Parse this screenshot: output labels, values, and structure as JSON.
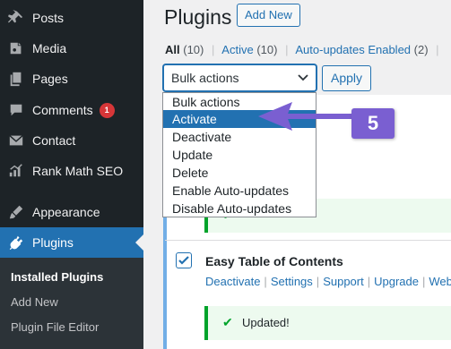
{
  "sidebar": {
    "items": [
      {
        "label": "Posts",
        "icon": "pin-icon"
      },
      {
        "label": "Media",
        "icon": "media-icon"
      },
      {
        "label": "Pages",
        "icon": "pages-icon"
      },
      {
        "label": "Comments",
        "icon": "comments-icon",
        "badge": "1"
      },
      {
        "label": "Contact",
        "icon": "mail-icon"
      },
      {
        "label": "Rank Math SEO",
        "icon": "chart-icon"
      },
      {
        "label": "Appearance",
        "icon": "brush-icon"
      },
      {
        "label": "Plugins",
        "icon": "plugin-icon",
        "active": true
      }
    ],
    "submenu": [
      "Installed Plugins",
      "Add New",
      "Plugin File Editor"
    ]
  },
  "header": {
    "title": "Plugins",
    "add_new": "Add New"
  },
  "filters": {
    "all": "All",
    "all_count": "(10)",
    "active": "Active",
    "active_count": "(10)",
    "auto": "Auto-updates Enabled",
    "auto_count": "(2)"
  },
  "bulk": {
    "selected": "Bulk actions",
    "apply": "Apply",
    "options": [
      "Bulk actions",
      "Activate",
      "Deactivate",
      "Update",
      "Delete",
      "Enable Auto-updates",
      "Disable Auto-updates"
    ]
  },
  "plugin_row": {
    "name": "Easy Table of Contents",
    "actions": [
      "Deactivate",
      "Settings",
      "Support",
      "Upgrade",
      "Webs"
    ]
  },
  "notice": {
    "text": "Updated!"
  },
  "annotation": {
    "number": "5"
  },
  "colors": {
    "sidebar_bg": "#1d2327",
    "accent": "#2271b1",
    "badge": "#d63638",
    "success": "#00a32a",
    "annotation": "#7a5fd1"
  }
}
